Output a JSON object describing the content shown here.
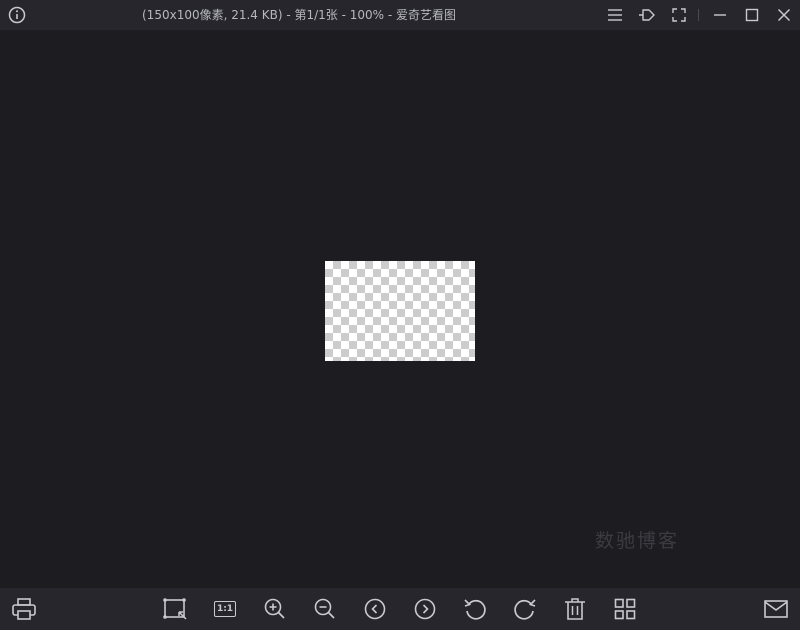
{
  "window": {
    "title": "(150x100像素, 21.4 KB) - 第1/1张 - 100% - 爱奇艺看图"
  },
  "titlebar": {
    "icons": [
      "info-icon",
      "menu-icon",
      "pin-icon",
      "fullscreen-icon",
      "minimize-icon",
      "maximize-icon",
      "close-icon"
    ]
  },
  "viewer": {
    "image_width": 150,
    "image_height": 100,
    "zoom": "100%",
    "watermark": "数驰博客"
  },
  "toolbar": {
    "buttons": [
      "print-icon",
      "crop-icon",
      "actual-size-icon",
      "zoom-in-icon",
      "zoom-out-icon",
      "previous-icon",
      "next-icon",
      "rotate-left-icon",
      "rotate-right-icon",
      "delete-icon",
      "grid-view-icon",
      "mail-icon"
    ],
    "actual_size_label": "1:1"
  },
  "colors": {
    "background": "#1c1c21",
    "bar": "#26262c",
    "icon": "#c9c9cf"
  }
}
